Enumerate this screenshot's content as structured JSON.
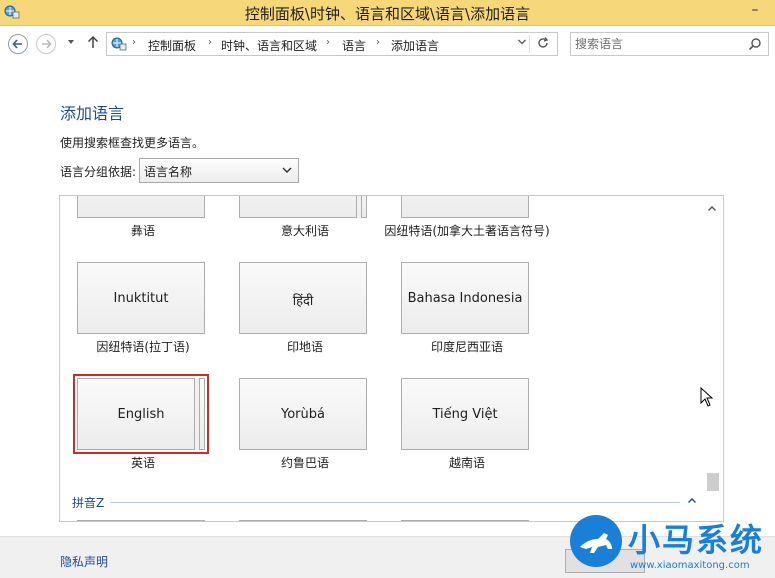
{
  "window": {
    "title": "控制面板\\时钟、语言和区域\\语言\\添加语言",
    "minimize": "–"
  },
  "address_bar": {
    "crumbs": [
      "控制面板",
      "时钟、语言和区域",
      "语言",
      "添加语言"
    ],
    "search_placeholder": "搜索语言"
  },
  "page": {
    "heading": "添加语言",
    "hint": "使用搜索框查找更多语言。",
    "group_label": "语言分组依据:",
    "group_value": "语言名称"
  },
  "language_grid": {
    "partial_captions": [
      "彝语",
      "意大利语",
      "因纽特语(加拿大土著语言符号)"
    ],
    "tiles": [
      {
        "tile_text": "Inuktitut",
        "caption": "因纽特语(拉丁语)"
      },
      {
        "tile_text": "हिंदी",
        "caption": "印地语"
      },
      {
        "tile_text": "Bahasa Indonesia",
        "caption": "印度尼西亚语"
      },
      {
        "tile_text": "English",
        "caption": "英语",
        "selected": true
      },
      {
        "tile_text": "Yorùbá",
        "caption": "约鲁巴语"
      },
      {
        "tile_text": "Tiếng Việt",
        "caption": "越南语"
      }
    ],
    "section_header": "拼音Z"
  },
  "footer": {
    "privacy": "隐私声明"
  },
  "watermark": {
    "name": "小马系统",
    "url": "www.xiaomaxitong.com"
  },
  "colors": {
    "titlebar": "#f6d77a",
    "link": "#1e4c96",
    "selection": "#cd2a2a"
  }
}
